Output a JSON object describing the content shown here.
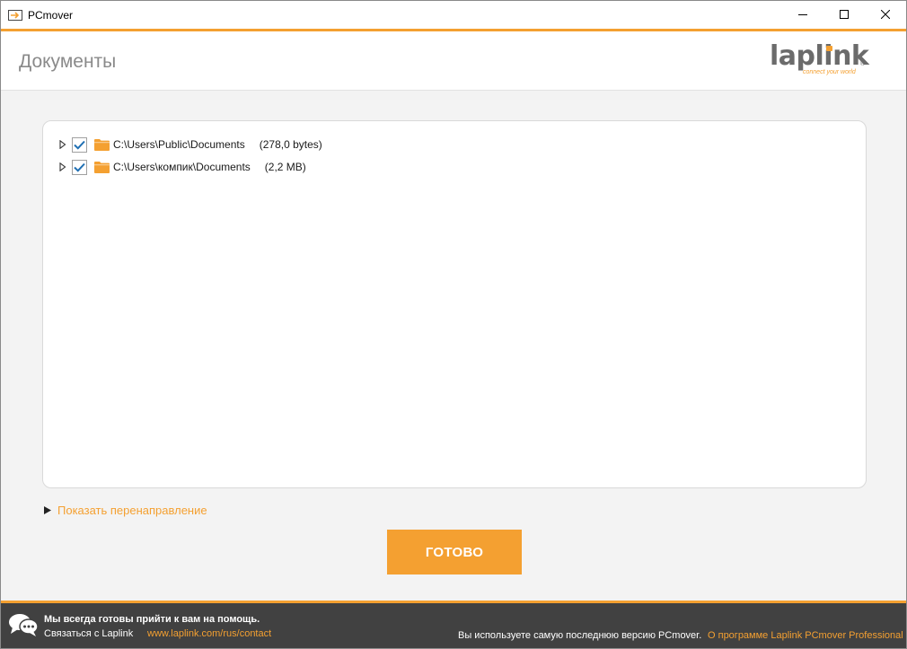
{
  "window": {
    "title": "PCmover",
    "icons": [
      "pcmover-app-icon",
      "minimize-icon",
      "maximize-icon",
      "close-icon"
    ]
  },
  "header": {
    "title": "Документы",
    "logo": {
      "word": "laplink",
      "registered": "®",
      "tagline": "connect your world"
    }
  },
  "tree": {
    "items": [
      {
        "path": "C:\\Users\\Public\\Documents",
        "size": "(278,0 bytes)",
        "checked": true,
        "expanded": false
      },
      {
        "path": "C:\\Users\\компик\\Documents",
        "size": "(2,2 MB)",
        "checked": true,
        "expanded": false
      }
    ]
  },
  "redirect": {
    "label": "Показать перенаправление"
  },
  "actions": {
    "done_label": "ГОТОВО"
  },
  "footer": {
    "help_title": "Мы всегда готовы прийти к вам на помощь.",
    "contact_label": "Связаться с Laplink",
    "contact_link": "www.laplink.com/rus/contact",
    "version_text": "Вы используете самую последнюю версию PCmover.",
    "about_link": "О программе Laplink PCmover Professional"
  },
  "colors": {
    "accent": "#f4a031",
    "footer_bg": "#414141",
    "checkmark": "#1f6fb3",
    "title_gray": "#8a8a8a"
  }
}
